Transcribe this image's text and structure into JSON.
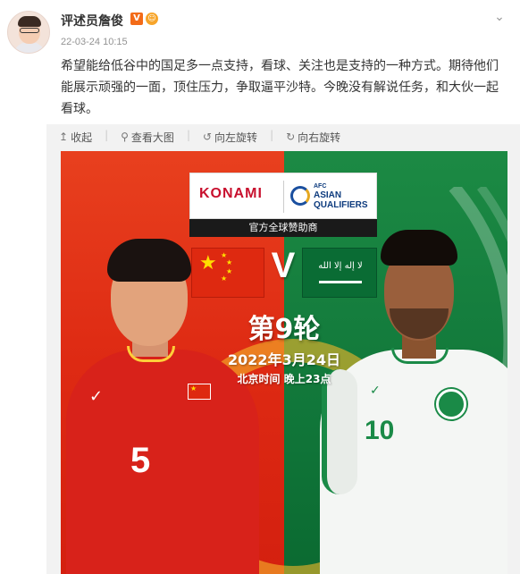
{
  "post": {
    "author": "评述员詹俊",
    "verified_badge": "V",
    "medal_badge": "☺",
    "timestamp": "22-03-24 10:15",
    "text": "希望能给低谷中的国足多一点支持，看球、关注也是支持的一种方式。期待他们能展示顽强的一面，顶住压力，争取逼平沙特。今晚没有解说任务，和大伙一起看球。"
  },
  "toolbar": {
    "collapse_label": "收起",
    "view_large_label": "查看大图",
    "rotate_left_label": "向左旋转",
    "rotate_right_label": "向右旋转"
  },
  "poster": {
    "sponsor_brand": "KONAMI",
    "afc_small": "AFC",
    "afc_line1": "ASIAN",
    "afc_line2": "QUALIFIERS",
    "sponsor_caption": "官方全球赞助商",
    "vs": "V",
    "round": "第9轮",
    "date": "2022年3月24日",
    "beijing_time": "北京时间 晚上23点",
    "flag_sa_script": "لا إله إلا الله",
    "left_jersey_number": "5",
    "right_jersey_number": "10"
  },
  "colors": {
    "china_red": "#de2a13",
    "saudi_green": "#11773a",
    "badge_orange": "#f36b18"
  },
  "icons": {
    "collapse": "arrow-up-icon",
    "view_large": "magnifier-icon",
    "rotate_left": "rotate-left-icon",
    "rotate_right": "rotate-right-icon",
    "menu": "chevron-down-icon"
  }
}
